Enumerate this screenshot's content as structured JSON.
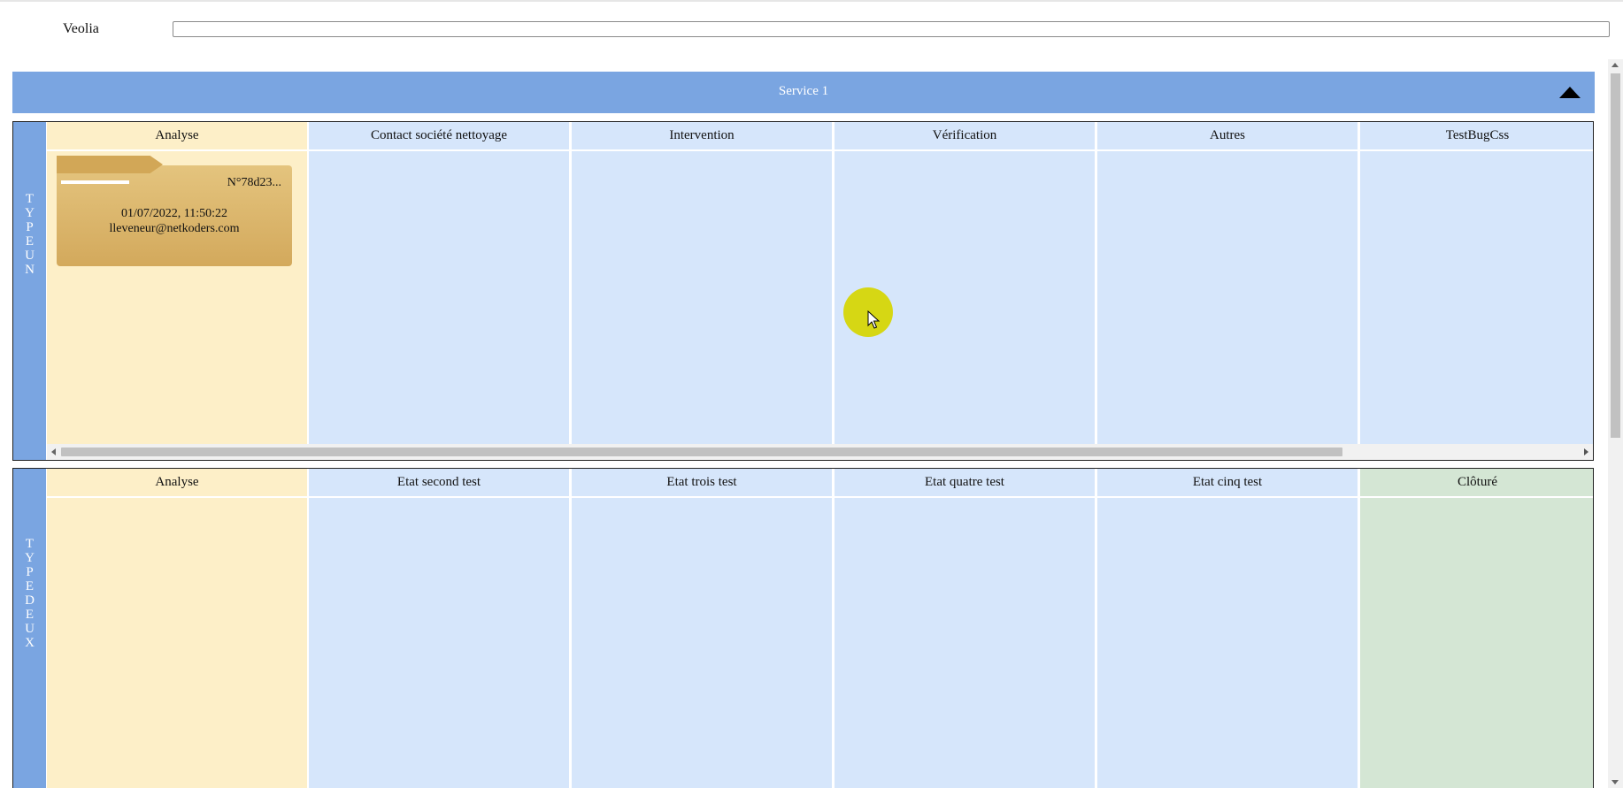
{
  "client": {
    "label": "Veolia",
    "value": ""
  },
  "service": {
    "title": "Service 1"
  },
  "boards": [
    {
      "type_letters": [
        "T",
        "Y",
        "P",
        "E",
        "U",
        "N"
      ],
      "columns": [
        {
          "label": "Analyse"
        },
        {
          "label": "Contact société nettoyage"
        },
        {
          "label": "Intervention"
        },
        {
          "label": "Vérification"
        },
        {
          "label": "Autres"
        },
        {
          "label": "TestBugCss"
        }
      ],
      "card": {
        "number": "N°78d23...",
        "date": "01/07/2022, 11:50:22",
        "email": "lleveneur@netkoders.com"
      }
    },
    {
      "type_letters": [
        "T",
        "Y",
        "P",
        "E",
        "D",
        "E",
        "U",
        "X"
      ],
      "columns": [
        {
          "label": "Analyse"
        },
        {
          "label": "Etat second test"
        },
        {
          "label": "Etat trois test"
        },
        {
          "label": "Etat quatre test"
        },
        {
          "label": "Etat cinq test"
        },
        {
          "label": "Clôturé"
        }
      ]
    }
  ],
  "colors": {
    "header_blue": "#7aa5e1",
    "analyse_bg": "#fdefc8",
    "column_bg": "#d6e6fb",
    "closed_bg": "#d4e6d4",
    "card_bg": "#dbb66b"
  }
}
